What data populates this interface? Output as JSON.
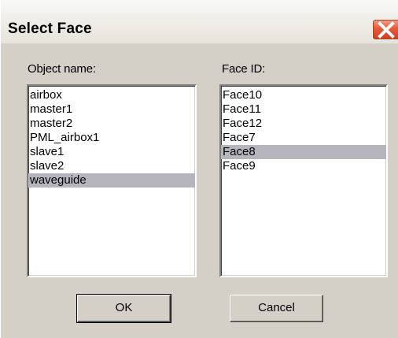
{
  "window": {
    "title": "Select Face"
  },
  "object_list": {
    "label": "Object name:",
    "items": [
      "airbox",
      "master1",
      "master2",
      "PML_airbox1",
      "slave1",
      "slave2",
      "waveguide"
    ],
    "selected": "waveguide"
  },
  "face_list": {
    "label": "Face ID:",
    "items": [
      "Face10",
      "Face11",
      "Face12",
      "Face7",
      "Face8",
      "Face9"
    ],
    "selected": "Face8"
  },
  "buttons": {
    "ok_label": "OK",
    "cancel_label": "Cancel"
  },
  "icons": {
    "close": "close-icon"
  },
  "colors": {
    "selection_bg": "#b6b5be",
    "dialog_bg": "#d4d0c8",
    "close_button": "#e4593a"
  }
}
